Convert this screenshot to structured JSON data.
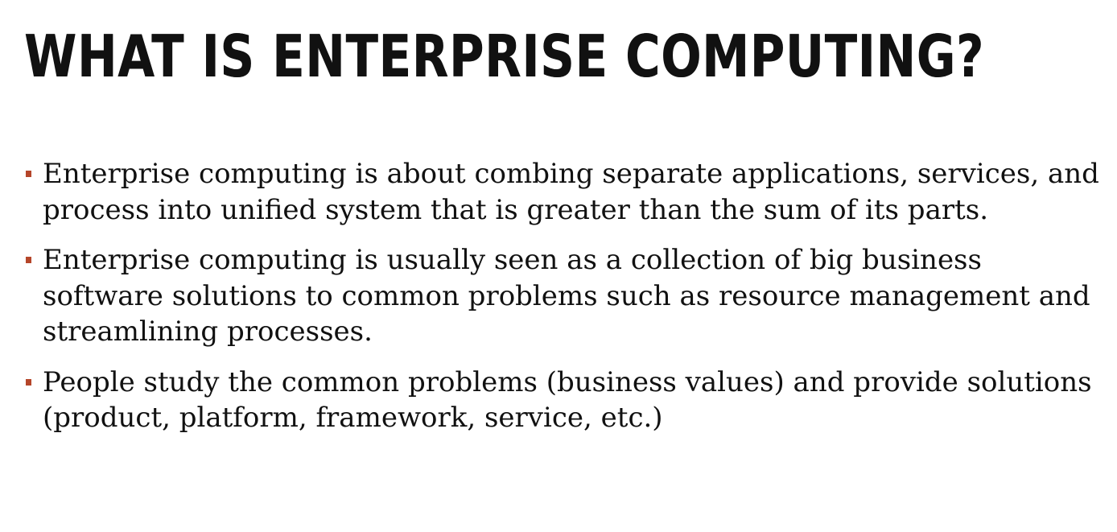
{
  "slide": {
    "title": "WHAT IS ENTERPRISE COMPUTING?",
    "bullets": [
      "Enterprise computing is about combing separate applications, services, and process into unified system that is greater than the sum of its parts.",
      "Enterprise computing is usually seen as a collection of big business software solutions to common problems such as resource management and streamlining processes.",
      "People study the common problems (business values) and provide solutions (product, platform, framework, service, etc.)"
    ],
    "colors": {
      "bullet": "#b5462a",
      "text": "#111111",
      "background": "#ffffff"
    }
  }
}
